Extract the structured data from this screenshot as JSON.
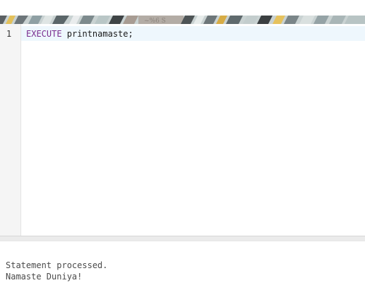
{
  "editor": {
    "line_numbers": [
      "1"
    ],
    "code_keyword": "EXECUTE",
    "code_rest": " printnamaste;"
  },
  "output": {
    "lines": [
      "Statement processed.",
      "Namaste Duniya!"
    ]
  }
}
